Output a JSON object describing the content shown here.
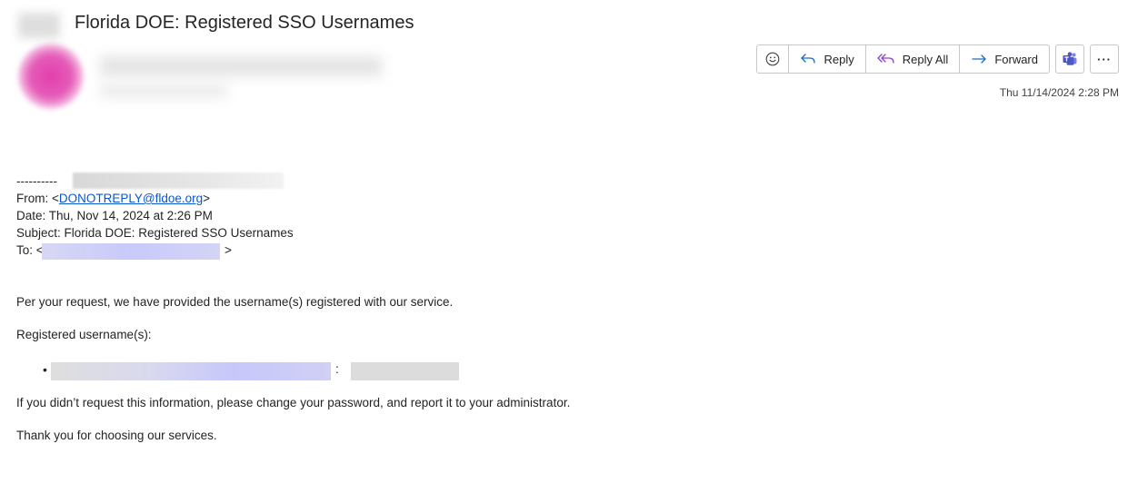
{
  "email": {
    "subject": "Florida DOE: Registered SSO Usernames",
    "timestamp": "Thu 11/14/2024 2:28 PM"
  },
  "toolbar": {
    "emoji_icon": "smiley-icon",
    "reply_label": "Reply",
    "reply_all_label": "Reply All",
    "forward_label": "Forward",
    "teams_icon": "teams-icon",
    "more_label": "···"
  },
  "forwarded": {
    "dashes": "----------",
    "from_prefix": "From: <",
    "from_email": "DONOTREPLY@fldoe.org",
    "from_suffix": ">",
    "date": "Date: Thu, Nov 14, 2024 at 2:26 PM",
    "subject": "Subject: Florida DOE: Registered SSO Usernames",
    "to_prefix": "To: <",
    "to_suffix": ">"
  },
  "body": {
    "intro": "Per your request, we have provided the username(s) registered with our service.",
    "usernames_heading": "Registered username(s):",
    "bullet": "•",
    "colon": ":",
    "warning": "If you didn’t request this information, please change your password, and report it to your administrator.",
    "thanks": "Thank you for choosing our services."
  },
  "colors": {
    "link": "#0b57d0",
    "teams_purple": "#5059c9",
    "icon_blue": "#1b6ac9",
    "avatar_pink": "#e23fae"
  }
}
